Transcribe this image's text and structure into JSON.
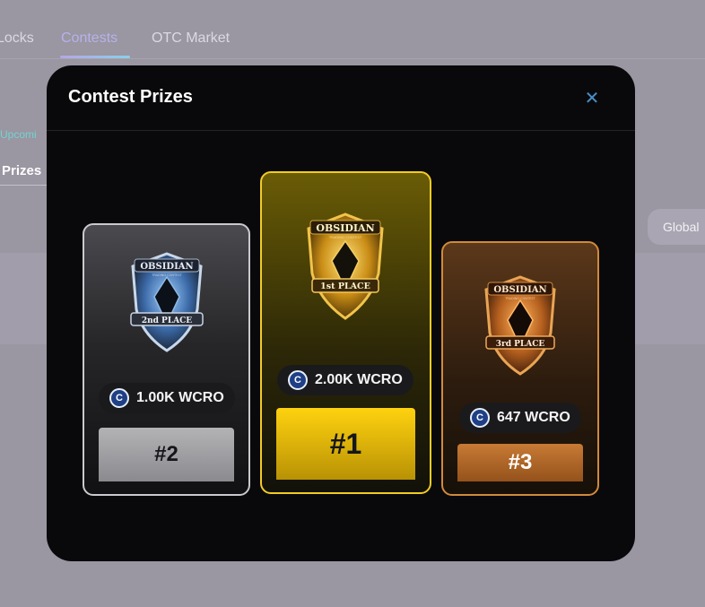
{
  "background": {
    "tabs": [
      {
        "label": "Locks",
        "active": false
      },
      {
        "label": "Contests",
        "active": true
      },
      {
        "label": "OTC Market",
        "active": false
      }
    ],
    "upcoming_label": "Upcomi",
    "prizes_tab_label": "Prizes",
    "scope_button_label": "Global"
  },
  "modal": {
    "title": "Contest Prizes",
    "close_icon": "close-icon",
    "prizes": [
      {
        "rank_label": "#2",
        "amount": "1.00K WCRO",
        "badge_brand": "OBSIDIAN",
        "badge_sub": "TRADING CONTEST",
        "badge_place": "2nd PLACE",
        "accent": "#c9c9cf"
      },
      {
        "rank_label": "#1",
        "amount": "2.00K WCRO",
        "badge_brand": "OBSIDIAN",
        "badge_sub": "TRADING CONTEST",
        "badge_place": "1st PLACE",
        "accent": "#f2cc26"
      },
      {
        "rank_label": "#3",
        "amount": "647 WCRO",
        "badge_brand": "OBSIDIAN",
        "badge_sub": "TRADING CONTEST",
        "badge_place": "3rd PLACE",
        "accent": "#d18a3c"
      }
    ],
    "token_icon": "wcro-coin-icon"
  }
}
